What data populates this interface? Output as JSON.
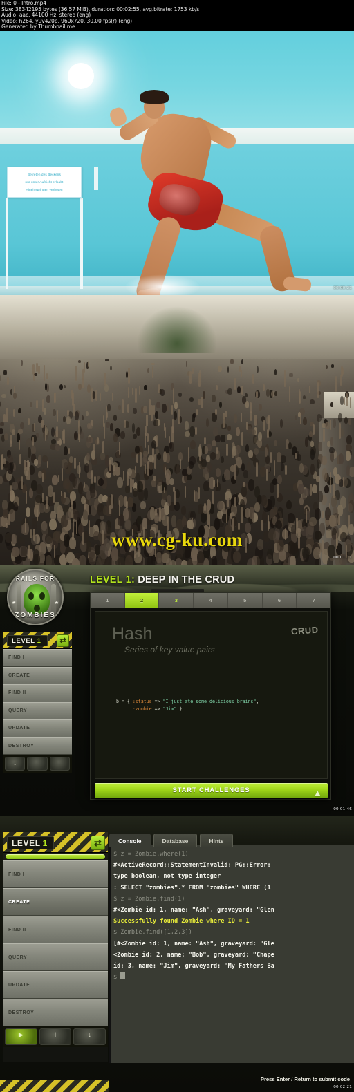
{
  "meta": {
    "line1": "File: 0 - Intro.mp4",
    "line2": "Size: 38342195 bytes (36.57 MiB), duration: 00:02:55, avg.bitrate: 1753 kb/s",
    "line3": "Audio: aac, 44100 Hz, stereo (eng)",
    "line4": "Video: h264, yuv420p, 960x720, 30.00 fps(r) (eng)",
    "line5": "Generated by Thumbnail me"
  },
  "watermark": "www.cg-ku.com",
  "timestamps": {
    "shot1": "00:00:21",
    "shot2": "00:01:11",
    "shot3": "00:01:46",
    "shot4": "00:02:21"
  },
  "shot1": {
    "sign_line1": "Betreten des Beckens",
    "sign_line2": "nur unter Aufsicht erlaubt",
    "sign_line3": "Hineinspringen verboten"
  },
  "shot3": {
    "logo": {
      "top_text": "RAILS FOR",
      "bottom_text": "ZOMBIES",
      "star": "★"
    },
    "title_level": "LEVEL 1:",
    "title_rest": " DEEP IN THE CRUD",
    "tooltip_line1": "Reviewing Ruby",
    "tooltip_line2": "Hashes",
    "steps": [
      {
        "n": "1",
        "state": "idle"
      },
      {
        "n": "2",
        "state": "done"
      },
      {
        "n": "3",
        "state": "cur"
      },
      {
        "n": "4",
        "state": "idle"
      },
      {
        "n": "5",
        "state": "idle"
      },
      {
        "n": "6",
        "state": "idle"
      },
      {
        "n": "7",
        "state": "idle"
      }
    ],
    "slide_heading": "Hash",
    "slide_subheading": "Series of key value pairs",
    "crud_label": "CRUD",
    "code_line1_pre": "b = { ",
    "code_line1_key": ":status",
    "code_line1_arrow": " => ",
    "code_line1_val": "\"I just ate some delicious brains\"",
    "code_line1_post": ",",
    "code_line2_key": ":zombie",
    "code_line2_arrow": " => ",
    "code_line2_val": "\"Jim\"",
    "code_line2_post": " }",
    "start_button": "START CHALLENGES",
    "start_icon": "⛰",
    "nav": {
      "level_label": "LEVEL",
      "level_number": "1",
      "swap_icon": "⇄",
      "items": [
        {
          "label": "FIND I",
          "active": false
        },
        {
          "label": "CREATE",
          "active": false
        },
        {
          "label": "FIND II",
          "active": false
        },
        {
          "label": "QUERY",
          "active": false
        },
        {
          "label": "UPDATE",
          "active": false
        },
        {
          "label": "DESTROY",
          "active": false
        }
      ],
      "footer_buttons": [
        {
          "icon": "↓",
          "kind": "download"
        },
        {
          "icon": "",
          "kind": "blank"
        },
        {
          "icon": "",
          "kind": "blank"
        }
      ]
    }
  },
  "shot4": {
    "nav": {
      "level_label": "LEVEL",
      "level_number": "1",
      "swap_icon": "⇄",
      "items": [
        {
          "label": "FIND I",
          "active": false
        },
        {
          "label": "CREATE",
          "active": true
        },
        {
          "label": "FIND II",
          "active": false
        },
        {
          "label": "QUERY",
          "active": false
        },
        {
          "label": "UPDATE",
          "active": false
        },
        {
          "label": "DESTROY",
          "active": false
        }
      ],
      "footer_buttons": [
        {
          "icon": "▶",
          "kind": "go"
        },
        {
          "icon": "i",
          "kind": "info"
        },
        {
          "icon": "↓",
          "kind": "download"
        }
      ]
    },
    "tabs": [
      {
        "label": "Console",
        "active": true
      },
      {
        "label": "Database",
        "active": false
      },
      {
        "label": "Hints",
        "active": false
      }
    ],
    "console_lines": [
      {
        "kind": "cmd",
        "text": "$ z = Zombie.where(1)"
      },
      {
        "kind": "res",
        "text": "#<ActiveRecord::StatementInvalid: PG::Error:"
      },
      {
        "kind": "res",
        "text": "type boolean, not type integer"
      },
      {
        "kind": "res",
        "text": ": SELECT \"zombies\".* FROM \"zombies\"  WHERE (1"
      },
      {
        "kind": "cmd",
        "text": "$ z = Zombie.find(1)"
      },
      {
        "kind": "res",
        "text": "#<Zombie id: 1, name: \"Ash\", graveyard: \"Glen"
      },
      {
        "kind": "ok",
        "text": "Successfully found Zombie where ID = 1"
      },
      {
        "kind": "cmd",
        "text": "$ Zombie.find([1,2,3])"
      },
      {
        "kind": "res",
        "text": "[#<Zombie id: 1, name: \"Ash\", graveyard: \"Gle"
      },
      {
        "kind": "res",
        "text": "<Zombie id: 2, name: \"Bob\", graveyard: \"Chape"
      },
      {
        "kind": "res",
        "text": "id: 3, name: \"Jim\", graveyard: \"My Fathers Ba"
      },
      {
        "kind": "prompt",
        "text": "$ "
      }
    ],
    "submit_hint": "Press Enter / Return to submit code"
  },
  "colors": {
    "accent_green": "#b5e61d",
    "hazard_yellow": "#d6c128",
    "console_ok": "#e6ea3a",
    "watermark_yellow": "#e9d80c"
  }
}
